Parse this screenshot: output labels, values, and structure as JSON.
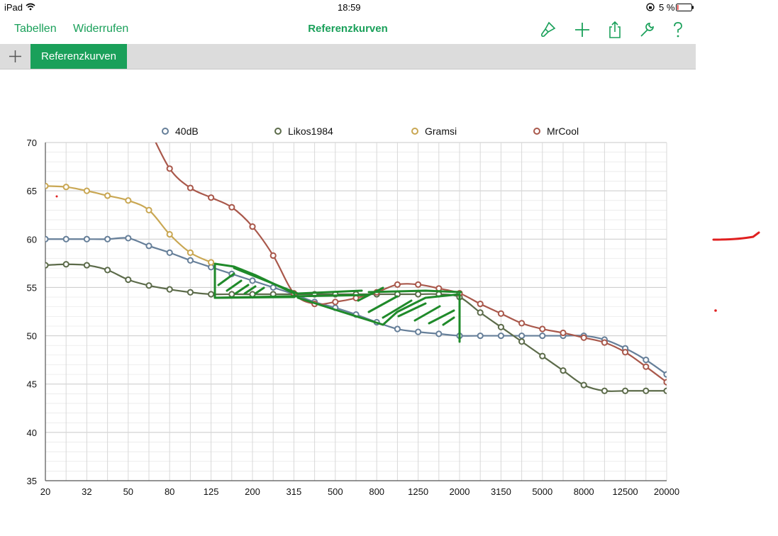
{
  "status": {
    "device": "iPad",
    "time": "18:59",
    "battery": "5 %"
  },
  "toolbar": {
    "tables_label": "Tabellen",
    "undo_label": "Widerrufen",
    "title": "Referenzkurven"
  },
  "tabs": {
    "add_icon": "plus-icon",
    "active_label": "Referenzkurven"
  },
  "icons": [
    "brush-icon",
    "plus-icon",
    "share-icon",
    "wrench-icon",
    "help-icon"
  ],
  "colors": {
    "accent": "#1aa05a",
    "series_40dB": "#667f99",
    "series_Likos1984": "#5c6b4a",
    "series_Gramsi": "#c9a753",
    "series_MrCool": "#a9584b",
    "annotation": "#1f8a2a"
  },
  "chart_data": {
    "type": "line",
    "title": "",
    "xlabel": "",
    "ylabel": "",
    "categories": [
      "20",
      "25",
      "32",
      "40",
      "50",
      "63",
      "80",
      "100",
      "125",
      "160",
      "200",
      "250",
      "315",
      "400",
      "500",
      "630",
      "800",
      "1000",
      "1250",
      "1600",
      "2000",
      "2500",
      "3150",
      "4000",
      "5000",
      "6300",
      "8000",
      "10000",
      "12500",
      "16000",
      "20000"
    ],
    "x_tick_labels": [
      "20",
      "32",
      "50",
      "80",
      "125",
      "200",
      "315",
      "500",
      "800",
      "1250",
      "2000",
      "3150",
      "5000",
      "8000",
      "12500",
      "20000"
    ],
    "y_ticks": [
      35,
      40,
      45,
      50,
      55,
      60,
      65,
      70
    ],
    "ylim": [
      35,
      70
    ],
    "grid": true,
    "legend": "top",
    "series": [
      {
        "name": "40dB",
        "color": "#667f99",
        "values": [
          60,
          60,
          60,
          60,
          60.1,
          59.3,
          58.6,
          57.8,
          57.1,
          56.4,
          55.7,
          55,
          54.3,
          53.5,
          52.9,
          52.2,
          51.4,
          50.7,
          50.4,
          50.2,
          50,
          50,
          50,
          50,
          50,
          50,
          50,
          49.6,
          48.7,
          47.5,
          46
        ]
      },
      {
        "name": "Likos1984",
        "color": "#5c6b4a",
        "values": [
          57.3,
          57.4,
          57.3,
          56.8,
          55.8,
          55.2,
          54.8,
          54.5,
          54.3,
          54.3,
          54.3,
          54.3,
          54.3,
          54.3,
          54.3,
          54.3,
          54.3,
          54.3,
          54.3,
          54.3,
          54,
          52.4,
          50.9,
          49.4,
          47.9,
          46.4,
          44.9,
          44.3,
          44.3,
          44.3,
          44.3
        ]
      },
      {
        "name": "Gramsi",
        "color": "#c9a753",
        "values": [
          65.5,
          65.4,
          65,
          64.5,
          64,
          63,
          60.5,
          58.6,
          57.6,
          null,
          null,
          null,
          null,
          null,
          null,
          null,
          null,
          null,
          null,
          null,
          null,
          null,
          null,
          null,
          null,
          null,
          null,
          null,
          null,
          null,
          null
        ]
      },
      {
        "name": "MrCool",
        "color": "#a9584b",
        "values": [
          null,
          null,
          null,
          null,
          null,
          71.5,
          67.3,
          65.3,
          64.3,
          63.3,
          61.3,
          58.3,
          54.4,
          53.3,
          53.5,
          53.9,
          54.5,
          55.3,
          55.3,
          54.9,
          54.4,
          53.3,
          52.3,
          51.3,
          50.7,
          50.3,
          49.8,
          49.3,
          48.3,
          46.8,
          45.2
        ]
      }
    ]
  }
}
